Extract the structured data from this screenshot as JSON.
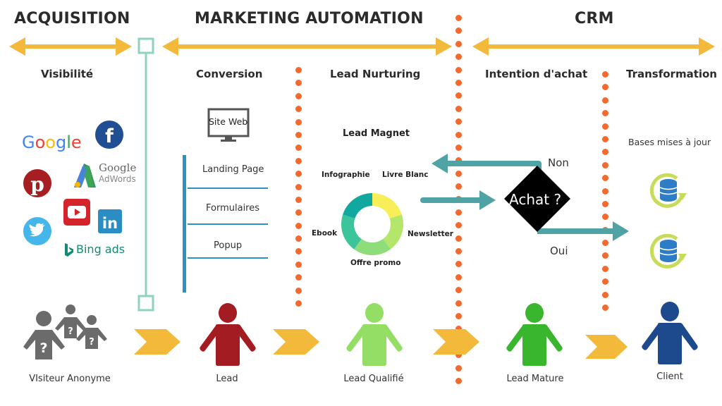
{
  "phases": [
    {
      "title": "ACQUISITION"
    },
    {
      "title": "MARKETING AUTOMATION"
    },
    {
      "title": "CRM"
    }
  ],
  "stages": [
    {
      "title": "Visibilité"
    },
    {
      "title": "Conversion"
    },
    {
      "title": "Lead Nurturing"
    },
    {
      "title": "Intention d'achat"
    },
    {
      "title": "Transformation"
    }
  ],
  "acquisition": {
    "channels": [
      {
        "name": "Google",
        "icon": "google-logo"
      },
      {
        "name": "Facebook",
        "icon": "facebook-icon"
      },
      {
        "name": "Pinterest",
        "icon": "pinterest-icon"
      },
      {
        "name": "Google AdWords",
        "line1": "Google",
        "line2": "AdWords",
        "icon": "adwords-icon"
      },
      {
        "name": "YouTube",
        "icon": "youtube-icon"
      },
      {
        "name": "Twitter",
        "icon": "twitter-icon"
      },
      {
        "name": "LinkedIn",
        "icon": "linkedin-icon",
        "glyph": "in"
      },
      {
        "name": "Bing ads",
        "icon": "bing-icon"
      }
    ]
  },
  "conversion": {
    "site_label": "Site Web",
    "items": [
      "Landing Page",
      "Formulaires",
      "Popup"
    ]
  },
  "nurturing": {
    "title": "Lead Magnet",
    "chart_data": {
      "type": "pie",
      "title": "Lead Magnet",
      "categories": [
        "Livre Blanc",
        "Newsletter",
        "Offre promo",
        "Ebook",
        "Infographie"
      ],
      "values": [
        20,
        20,
        20,
        20,
        20
      ],
      "colors": [
        "#f7ee58",
        "#b3e66a",
        "#8edc7a",
        "#3cc49a",
        "#11a8a0"
      ]
    }
  },
  "decision": {
    "label": "Achat ?",
    "no_label": "Non",
    "yes_label": "Oui"
  },
  "transformation": {
    "label": "Bases mises à jour"
  },
  "personas": [
    {
      "label": "VIsiteur Anonyme",
      "color": "#6b6b6b"
    },
    {
      "label": "Lead",
      "color": "#a31c22"
    },
    {
      "label": "Lead Qualifié",
      "color": "#94de66"
    },
    {
      "label": "Lead Mature",
      "color": "#39b52e"
    },
    {
      "label": "Client",
      "color": "#1d4a8c"
    }
  ],
  "colors": {
    "arrow_yellow": "#f2b93b",
    "dots_orange": "#f26a2e",
    "teal": "#4fa3a5",
    "mint": "#8fd3bd",
    "blue_bar": "#2b93bd"
  }
}
